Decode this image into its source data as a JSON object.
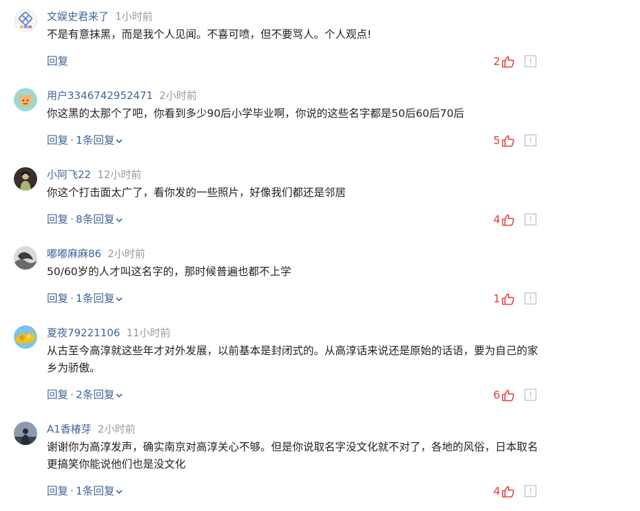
{
  "comments": [
    {
      "username": "文娱史君来了",
      "time": "1小时前",
      "text": "不是有意抹黑，而是我个人见闻。不喜可喷，但不要骂人。个人观点!",
      "reply_label": "回复",
      "reply_count": "",
      "likes": "2",
      "avatar_icon": "avatar-logo-icon"
    },
    {
      "username": "用户3346742952471",
      "time": "2小时前",
      "text": "你这黑的太那个了吧，你看到多少90后小学毕业啊，你说的这些名字都是50后60后70后",
      "reply_label": "回复",
      "reply_count": "1条回复",
      "likes": "5",
      "avatar_icon": "avatar-cartoon-icon"
    },
    {
      "username": "小阿飞22",
      "time": "12小时前",
      "text": "你这个打击面太广了，看你发的一些照片，好像我们都还是邻居",
      "reply_label": "回复",
      "reply_count": "8条回复",
      "likes": "4",
      "avatar_icon": "avatar-person-icon"
    },
    {
      "username": "嘟嘟麻麻86",
      "time": "2小时前",
      "text": "50/60岁的人才叫这名字的，那时候普遍也都不上学",
      "reply_label": "回复",
      "reply_count": "1条回复",
      "likes": "1",
      "avatar_icon": "avatar-photo-icon"
    },
    {
      "username": "夏夜79221106",
      "time": "11小时前",
      "text": "从古至今高淳就这些年才对外发展，以前基本是封闭式的。从高淳话来说还是原始的话语，要为自己的家乡为骄傲。",
      "reply_label": "回复",
      "reply_count": "2条回复",
      "likes": "6",
      "avatar_icon": "avatar-flower-icon"
    },
    {
      "username": "A1香椿芽",
      "time": "2小时前",
      "text": "谢谢你为高淳发声，确实南京对高淳关心不够。但是你说取名字没文化就不对了，各地的风俗，日本取名更搞笑你能说他们也是没文化",
      "reply_label": "回复",
      "reply_count": "1条回复",
      "likes": "4",
      "avatar_icon": "avatar-silhouette-icon"
    }
  ],
  "colors": {
    "username": "#406599",
    "time": "#999999",
    "text": "#222222",
    "like_accent": "#e8403a",
    "report_icon": "#c8c8c8"
  },
  "icons": {
    "like": "thumbs-up-icon",
    "report": "report-icon",
    "expand": "chevron-down-icon"
  }
}
